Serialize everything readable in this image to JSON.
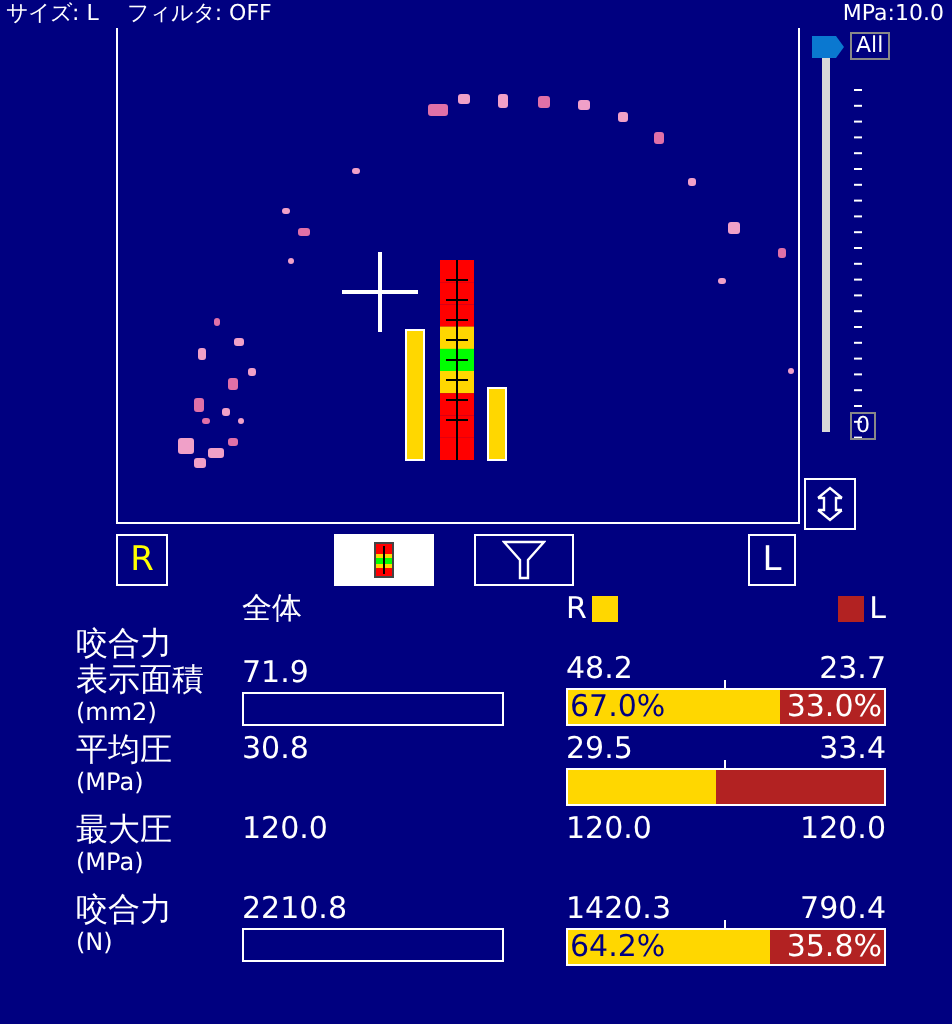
{
  "header": {
    "size": "サイズ: L",
    "filter": "フィルタ: OFF",
    "scale": "MPa:10.0"
  },
  "slider": {
    "top_label": "All",
    "bottom_label": "0",
    "level": 1
  },
  "toolbar": {
    "right": "R",
    "left": "L"
  },
  "legend": {
    "right": "R",
    "left": "L"
  },
  "columns": {
    "total": "全体"
  },
  "rows": [
    {
      "label": [
        "咬合力",
        "表示面積"
      ],
      "unit": "(mm2)",
      "total": "71.9",
      "r": "48.2",
      "l": "23.7",
      "total_bar": true,
      "split": {
        "level": 0.67,
        "r_pct": "67.0%",
        "l_pct": "33.0%"
      }
    },
    {
      "label": [
        "平均圧"
      ],
      "unit": "(MPa)",
      "total": "30.8",
      "r": "29.5",
      "l": "33.4",
      "total_bar": false,
      "split": {
        "level": 0.47
      }
    },
    {
      "label": [
        "最大圧"
      ],
      "unit": "(MPa)",
      "total": "120.0",
      "r": "120.0",
      "l": "120.0",
      "total_bar": false
    },
    {
      "label": [
        "咬合力"
      ],
      "unit": "(N)",
      "total": "2210.8",
      "r": "1420.3",
      "l": "790.4",
      "total_bar": true,
      "split": {
        "level": 0.64,
        "r_pct": "64.2%",
        "l_pct": "35.8%"
      }
    }
  ]
}
